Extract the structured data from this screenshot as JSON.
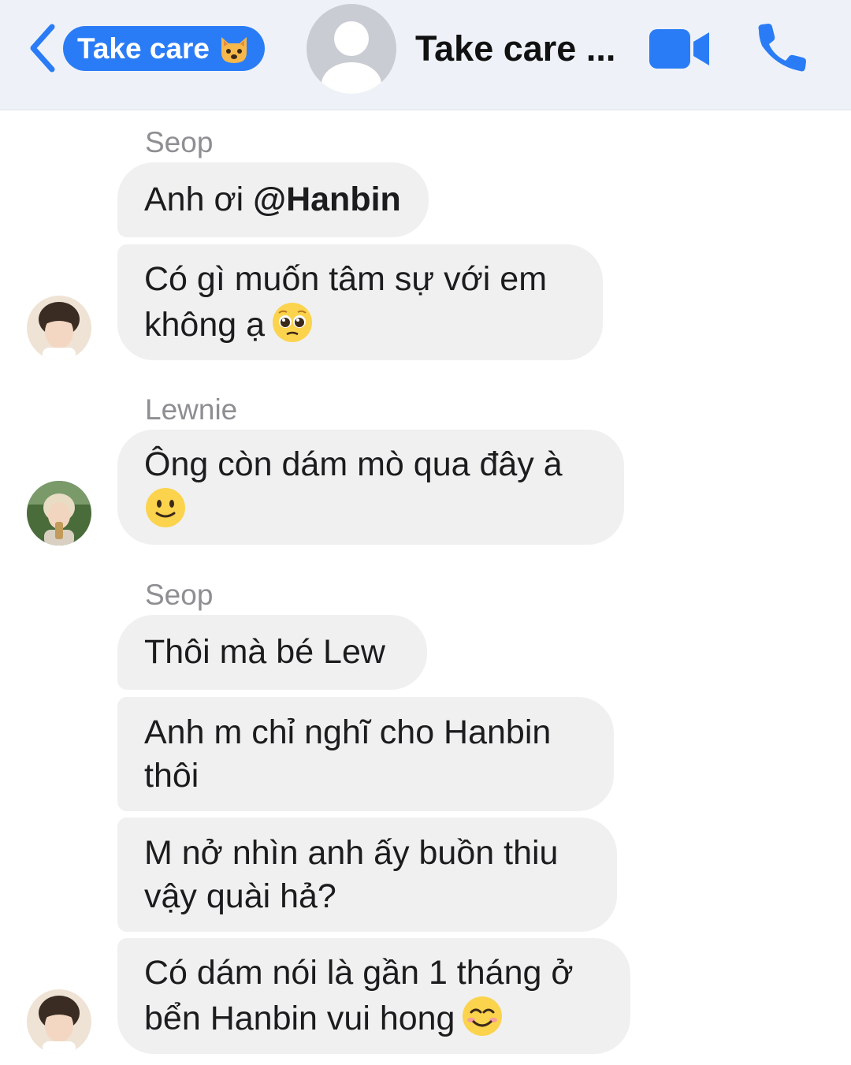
{
  "header": {
    "back_label": "Take care",
    "title": "Take care ...",
    "accent_color": "#2a7cf6",
    "icons": [
      "chevron-left-icon",
      "cat-face-icon",
      "video-camera-icon",
      "phone-icon"
    ]
  },
  "messages": [
    {
      "sender": "Seop"
    },
    {
      "text_prefix": "Anh ơi ",
      "mention": "@Hanbin"
    },
    {
      "line1": "Có gì muốn tâm sự với em",
      "line2": "không ạ",
      "emoji": "pleading-face-icon"
    },
    {
      "sender": "Lewnie"
    },
    {
      "line1": "Ông còn dám mò qua đây à",
      "emoji": "slightly-smiling-face-icon"
    },
    {
      "sender": "Seop"
    },
    {
      "text": "Thôi mà bé Lew"
    },
    {
      "line1": "Anh m chỉ nghĩ cho Hanbin",
      "line2": "thôi"
    },
    {
      "line1": "M nở nhìn anh ấy buồn thiu",
      "line2": "vậy quài hả?"
    },
    {
      "line1": "Có dám nói là gần 1 tháng ở",
      "line2": "bển Hanbin vui hong",
      "emoji": "smiling-face-icon"
    }
  ]
}
